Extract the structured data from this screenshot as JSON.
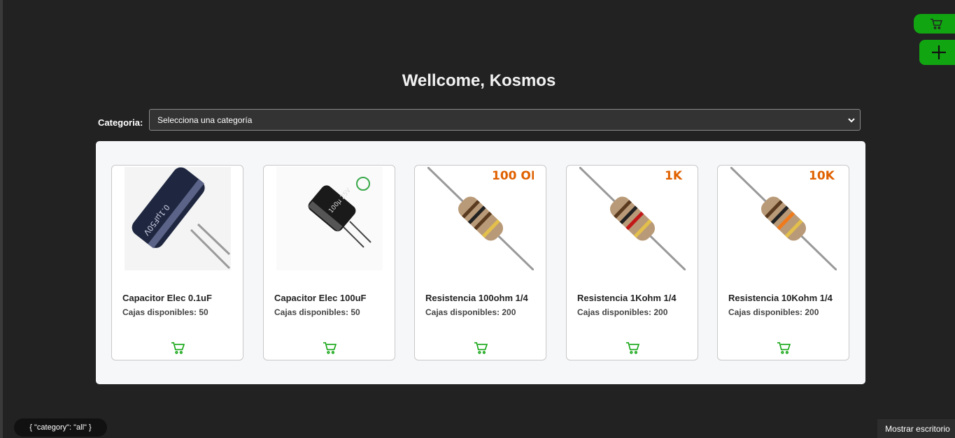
{
  "header": {
    "title": "Wellcome, Kosmos"
  },
  "filter": {
    "label": "Categoria:",
    "selected": "Selecciona una categoría"
  },
  "products": [
    {
      "name": "Capacitor Elec 0.1uF",
      "stock": "Cajas disponibles: 50",
      "image_icon": "capacitor-image",
      "badge": ""
    },
    {
      "name": "Capacitor Elec 100uF",
      "stock": "Cajas disponibles: 50",
      "image_icon": "capacitor-image",
      "badge": ""
    },
    {
      "name": "Resistencia 100ohm 1/4",
      "stock": "Cajas disponibles: 200",
      "image_icon": "resistor-image",
      "badge": "100 OHM"
    },
    {
      "name": "Resistencia 1Kohm 1/4",
      "stock": "Cajas disponibles: 200",
      "image_icon": "resistor-image",
      "badge": "1K"
    },
    {
      "name": "Resistencia 10Kohm 1/4",
      "stock": "Cajas disponibles: 200",
      "image_icon": "resistor-image",
      "badge": "10K"
    }
  ],
  "status_pill": "{ \"category\": \"all\" }",
  "taskbar": {
    "show_desktop": "Mostrar escritorio"
  },
  "colors": {
    "accent": "#12a512",
    "background": "#222222",
    "panel": "#f6f7f9"
  }
}
